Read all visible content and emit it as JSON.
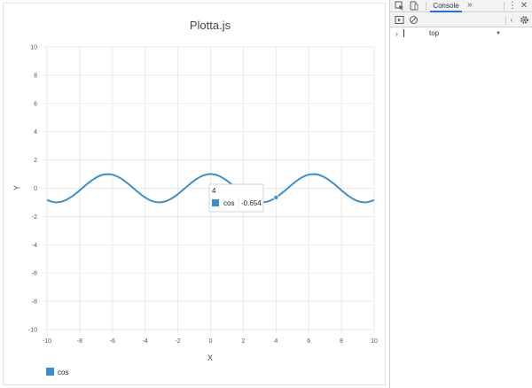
{
  "plot": {
    "title": "Plotta.js",
    "xlabel": "X",
    "ylabel": "Y",
    "legend_label": "cos",
    "tooltip": {
      "x_value": "4",
      "series": "cos",
      "y_value": "-0.654"
    }
  },
  "devtools": {
    "console_tab": "Console",
    "more_tabs": "»",
    "context": "top",
    "prompt": "›"
  },
  "colors": {
    "series": "#3a8ed0",
    "grid": "#e0e0e0",
    "text": "#444444",
    "devtools_accent": "#1a73e8"
  },
  "chart_data": {
    "type": "line",
    "title": "Plotta.js",
    "xlabel": "X",
    "ylabel": "Y",
    "xlim": [
      -10,
      10
    ],
    "ylim": [
      -10,
      10
    ],
    "x_ticks": [
      -10,
      -8,
      -6,
      -4,
      -2,
      0,
      2,
      4,
      6,
      8,
      10
    ],
    "y_ticks": [
      -10,
      -8,
      -6,
      -4,
      -2,
      0,
      2,
      4,
      6,
      8,
      10
    ],
    "grid": true,
    "legend": "bottom-left",
    "series": [
      {
        "name": "cos",
        "x": [
          -10,
          -9.5,
          -9,
          -8.5,
          -8,
          -7.5,
          -7,
          -6.5,
          -6,
          -5.5,
          -5,
          -4.5,
          -4,
          -3.5,
          -3,
          -2.5,
          -2,
          -1.5,
          -1,
          -0.5,
          0,
          0.5,
          1,
          1.5,
          2,
          2.5,
          3,
          3.5,
          4,
          4.5,
          5,
          5.5,
          6,
          6.5,
          7,
          7.5,
          8,
          8.5,
          9,
          9.5,
          10
        ],
        "y": [
          -0.839,
          -0.997,
          -0.911,
          -0.602,
          -0.146,
          0.347,
          0.754,
          0.977,
          0.96,
          0.709,
          0.284,
          -0.211,
          -0.654,
          -0.936,
          -0.99,
          -0.801,
          -0.416,
          0.071,
          0.54,
          0.878,
          1,
          0.878,
          0.54,
          0.071,
          -0.416,
          -0.801,
          -0.99,
          -0.936,
          -0.654,
          -0.211,
          0.284,
          0.709,
          0.96,
          0.977,
          0.754,
          0.347,
          -0.146,
          -0.602,
          -0.911,
          -0.997,
          -0.839
        ]
      }
    ],
    "highlight": {
      "x": 4,
      "y": -0.654
    }
  }
}
